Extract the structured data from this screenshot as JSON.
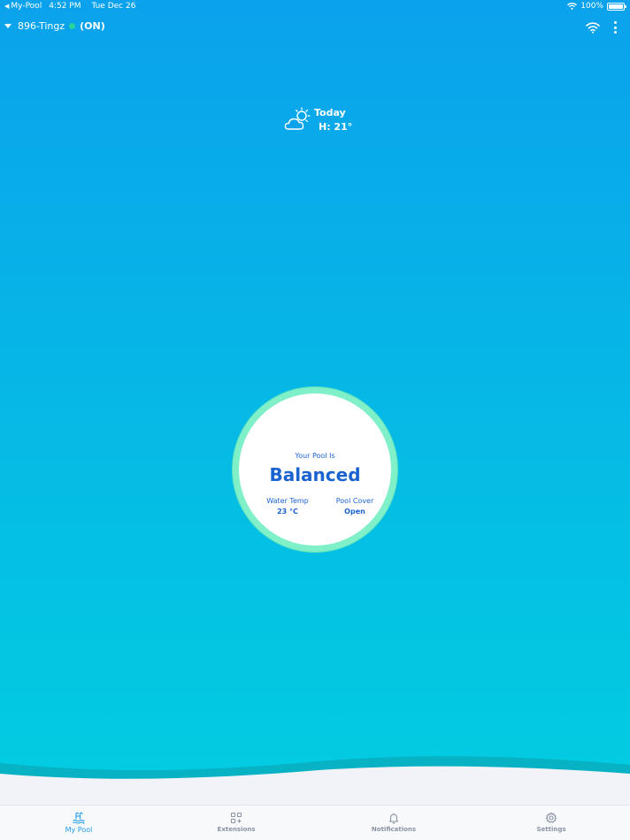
{
  "statusbar": {
    "back_app": "My-Pool",
    "time": "4:52 PM",
    "date": "Tue Dec 26",
    "battery": "100%"
  },
  "header": {
    "device_name": "896-Tingz",
    "device_state": "(ON)"
  },
  "weather": {
    "day": "Today",
    "high": "H: 21°",
    "icon": "partly-sunny-icon"
  },
  "pool": {
    "caption": "Your Pool Is",
    "state": "Balanced",
    "water_temp_label": "Water Temp",
    "water_temp_value": "23 °C",
    "pool_cover_label": "Pool Cover",
    "pool_cover_value": "Open"
  },
  "tabs": [
    {
      "label": "My Pool",
      "icon": "pool-ladder-icon",
      "active": true
    },
    {
      "label": "Extensions",
      "icon": "grid-plus-icon",
      "active": false
    },
    {
      "label": "Notifications",
      "icon": "bell-icon",
      "active": false
    },
    {
      "label": "Settings",
      "icon": "gear-icon",
      "active": false
    }
  ],
  "colors": {
    "gradient_top": "#0aa2ec",
    "gradient_bottom": "#02cfe0",
    "ring": "#7ff0c8",
    "accent_text": "#1b63cf",
    "tab_active": "#1f9be8",
    "status_on": "#28d39b"
  }
}
